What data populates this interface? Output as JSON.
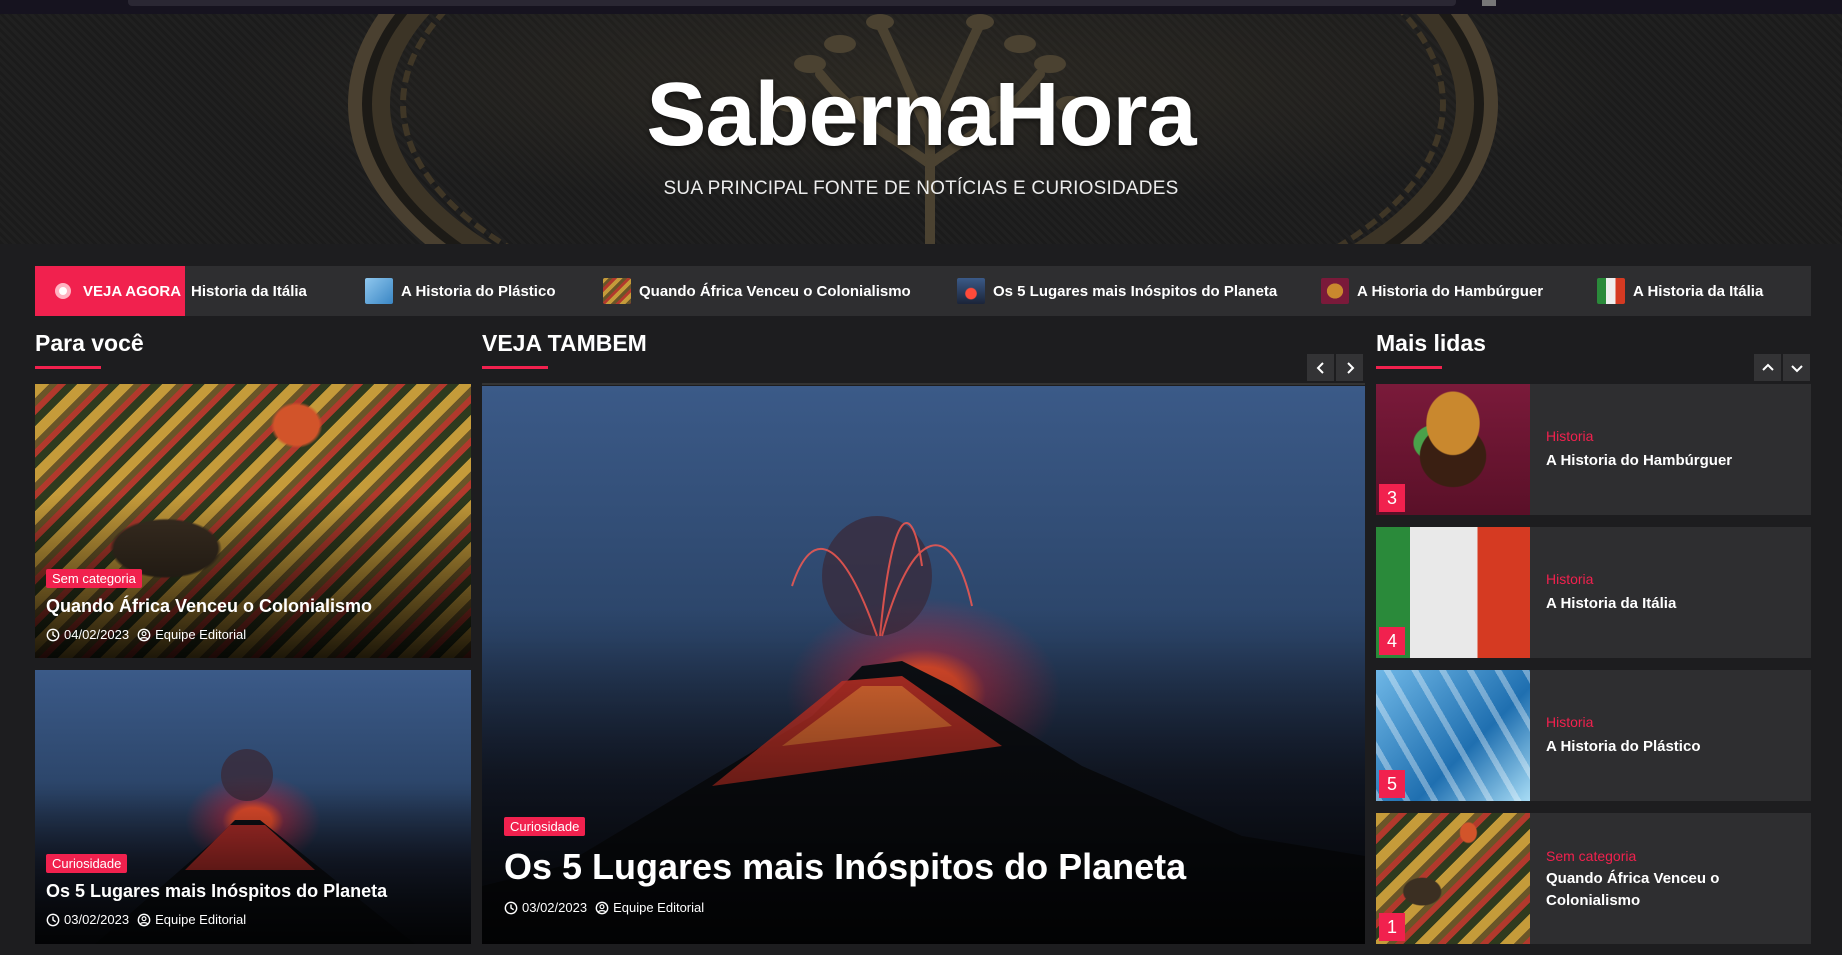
{
  "site": {
    "title": "SabernaHora",
    "tagline": "SUA PRINCIPAL FONTE DE NOTÍCIAS E CURIOSIDADES"
  },
  "ticker": {
    "label": "VEJA AGORA",
    "items": [
      {
        "title": "Historia da Itália"
      },
      {
        "title": "A Historia do Plástico"
      },
      {
        "title": "Quando África Venceu o Colonialismo"
      },
      {
        "title": "Os 5 Lugares mais Inóspitos do Planeta"
      },
      {
        "title": "A Historia do Hambúrguer"
      },
      {
        "title": "A Historia da Itália"
      }
    ]
  },
  "para_voce": {
    "heading": "Para você",
    "cards": [
      {
        "category": "Sem categoria",
        "title": "Quando África Venceu o Colonialismo",
        "date": "04/02/2023",
        "author": "Equipe Editorial"
      },
      {
        "category": "Curiosidade",
        "title": "Os 5 Lugares mais Inóspitos do Planeta",
        "date": "03/02/2023",
        "author": "Equipe Editorial"
      }
    ]
  },
  "veja_tambem": {
    "heading": "VEJA TAMBEM",
    "featured": {
      "category": "Curiosidade",
      "title": "Os 5 Lugares mais Inóspitos do Planeta",
      "date": "03/02/2023",
      "author": "Equipe Editorial"
    }
  },
  "mais_lidas": {
    "heading": "Mais lidas",
    "items": [
      {
        "rank": "3",
        "category": "Historia",
        "title": "A Historia do Hambúrguer"
      },
      {
        "rank": "4",
        "category": "Historia",
        "title": "A Historia da Itália"
      },
      {
        "rank": "5",
        "category": "Historia",
        "title": "A Historia do Plástico"
      },
      {
        "rank": "1",
        "category": "Sem categoria",
        "title": "Quando África Venceu o Colonialismo"
      }
    ]
  },
  "colors": {
    "accent": "#f1214e",
    "background": "#1d1d1f",
    "panel": "#2e2e30"
  }
}
